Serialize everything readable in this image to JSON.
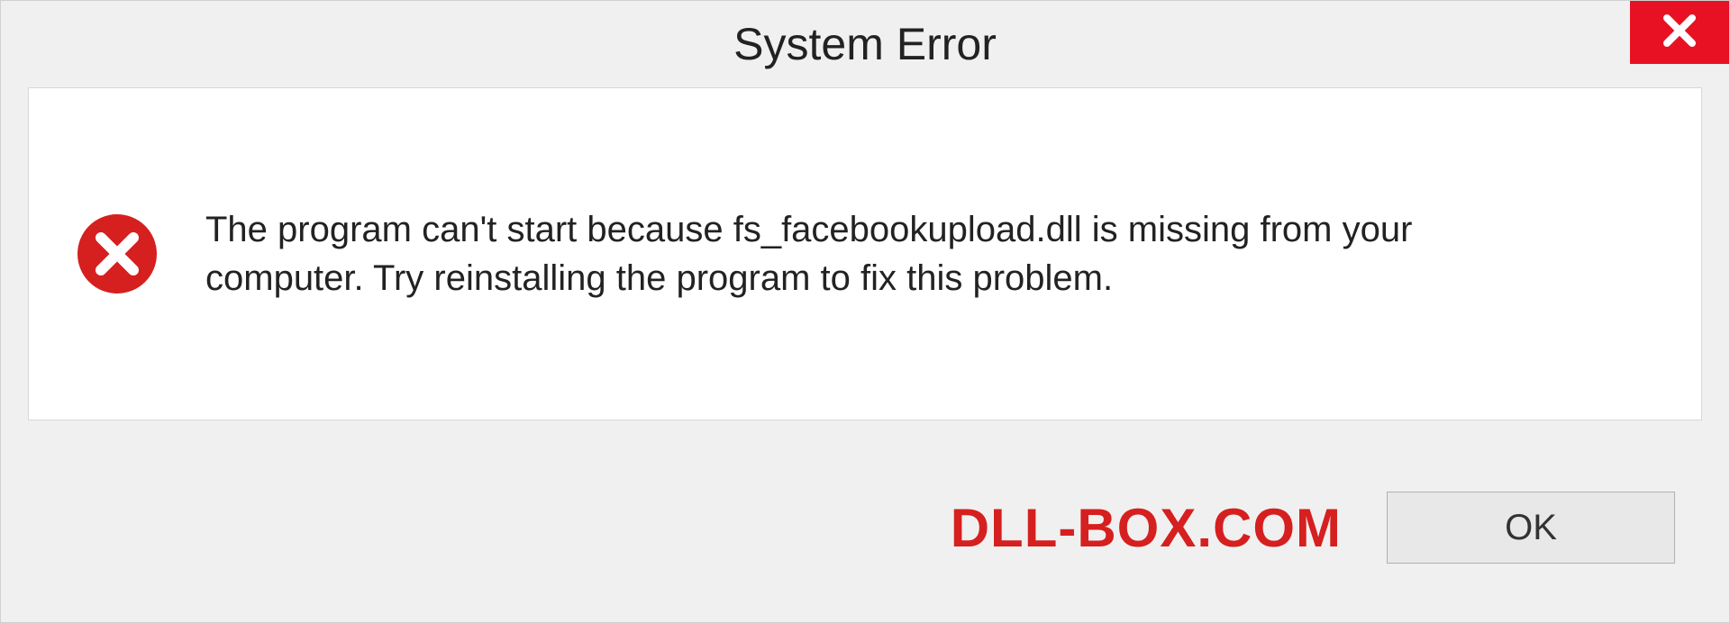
{
  "titlebar": {
    "title": "System Error"
  },
  "content": {
    "message": "The program can't start because fs_facebookupload.dll is missing from your computer. Try reinstalling the program to fix this problem."
  },
  "footer": {
    "watermark": "DLL-BOX.COM",
    "ok_label": "OK"
  }
}
